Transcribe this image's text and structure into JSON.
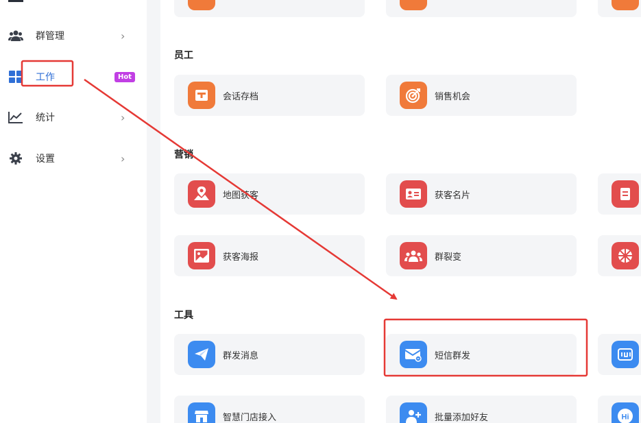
{
  "sidebar": {
    "items": [
      {
        "label": "群管理",
        "icon": "users-icon",
        "arrow": "›"
      },
      {
        "label": "工作",
        "icon": "grid-icon",
        "badge": "Hot"
      },
      {
        "label": "统计",
        "icon": "chart-icon",
        "arrow": "›"
      },
      {
        "label": "设置",
        "icon": "gear-icon",
        "arrow": "›"
      }
    ]
  },
  "sections": [
    {
      "title": "员工",
      "cards": [
        {
          "label": "会话存档",
          "icon": "archive-icon",
          "color": "#f07a3a"
        },
        {
          "label": "销售机会",
          "icon": "target-icon",
          "color": "#f07a3a"
        }
      ]
    },
    {
      "title": "营销",
      "cards": [
        {
          "label": "地图获客",
          "icon": "map-pin-icon",
          "color": "#e24d4d"
        },
        {
          "label": "获客名片",
          "icon": "id-card-icon",
          "color": "#e24d4d"
        },
        {
          "label": "获客海报",
          "icon": "image-icon",
          "color": "#e24d4d"
        },
        {
          "label": "群裂变",
          "icon": "group-icon",
          "color": "#e24d4d"
        }
      ]
    },
    {
      "title": "工具",
      "cards": [
        {
          "label": "群发消息",
          "icon": "paper-plane-icon",
          "color": "#3c8bf0"
        },
        {
          "label": "短信群发",
          "icon": "envelope-icon",
          "color": "#3c8bf0"
        },
        {
          "label": "智慧门店接入",
          "icon": "store-icon",
          "color": "#3c8bf0"
        },
        {
          "label": "批量添加好友",
          "icon": "add-user-icon",
          "color": "#3c8bf0"
        }
      ]
    }
  ],
  "colors": {
    "highlight": "#e53935",
    "hot": "#c13fe4"
  }
}
